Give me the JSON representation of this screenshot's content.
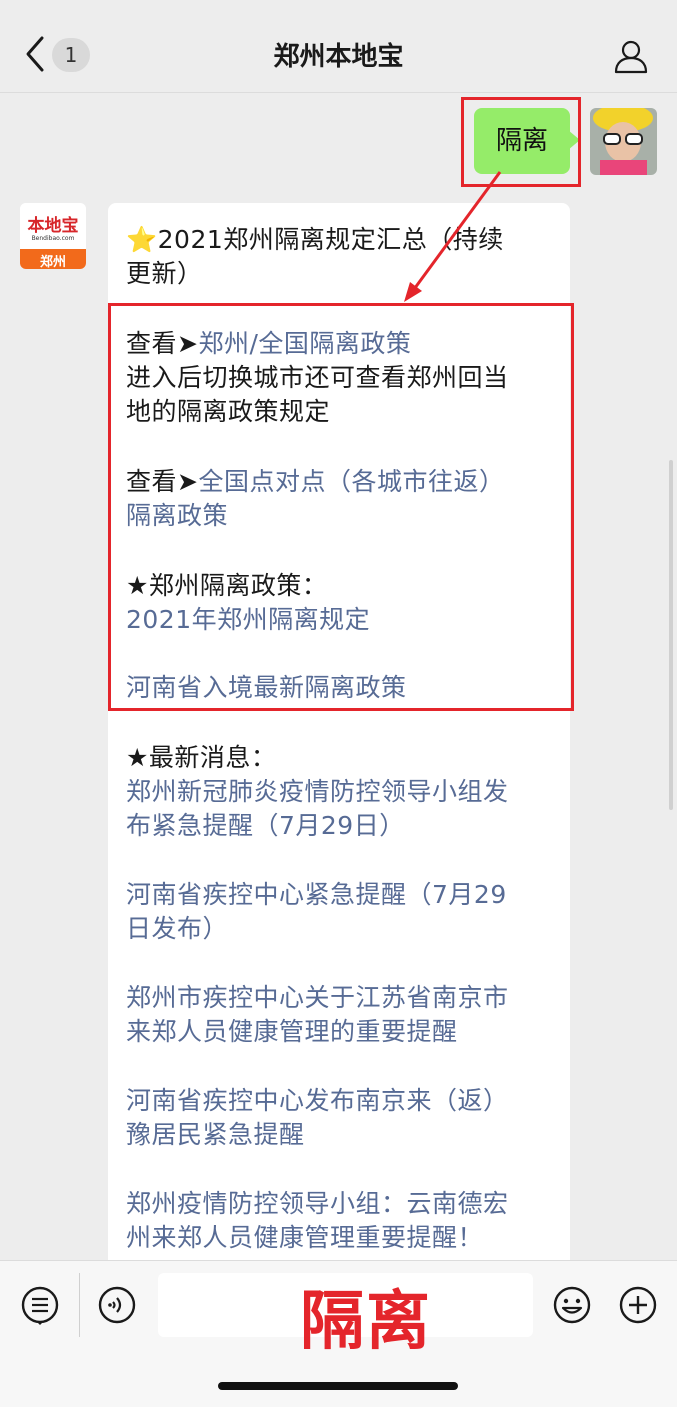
{
  "header": {
    "title": "郑州本地宝",
    "unread_count": "1"
  },
  "chat": {
    "user_message": "隔离",
    "reply_title": "⭐2021郑州隔离规定汇总（持续",
    "reply_title_cont": "更新）",
    "section1_prefix": "查看➤",
    "section1_link": "郑州/全国隔离政策",
    "section1_desc_line1": "进入后切换城市还可查看郑州回当",
    "section1_desc_line2": "地的隔离政策规定",
    "section2_prefix": "查看➤",
    "section2_link_line1": "全国点对点（各城市往返）",
    "section2_link_line2": "隔离政策",
    "zhengzhou_policy_heading": "★郑州隔离政策：",
    "zhengzhou_policy_link": "2021年郑州隔离规定",
    "henan_entry_link": "河南省入境最新隔离政策",
    "news_heading": "★最新消息：",
    "news": [
      {
        "line1": "郑州新冠肺炎疫情防控领导小组发",
        "line2": "布紧急提醒（7月29日）"
      },
      {
        "line1": "河南省疾控中心紧急提醒（7月29",
        "line2": "日发布）"
      },
      {
        "line1": "郑州市疾控中心关于江苏省南京市",
        "line2": "来郑人员健康管理的重要提醒"
      },
      {
        "line1": "河南省疾控中心发布南京来（返）",
        "line2": "豫居民紧急提醒"
      },
      {
        "line1": "郑州疫情防控领导小组：云南德宏",
        "line2": "州来郑人员健康管理重要提醒！"
      }
    ],
    "account_logo_text": "本地宝",
    "account_logo_sub": "Bendibao.com",
    "account_logo_city": "郑州"
  },
  "annotation": {
    "overlay_text": "隔离",
    "accent_color": "#e4252b"
  },
  "colors": {
    "link": "#576b95",
    "bubble_green": "#95ec69"
  }
}
